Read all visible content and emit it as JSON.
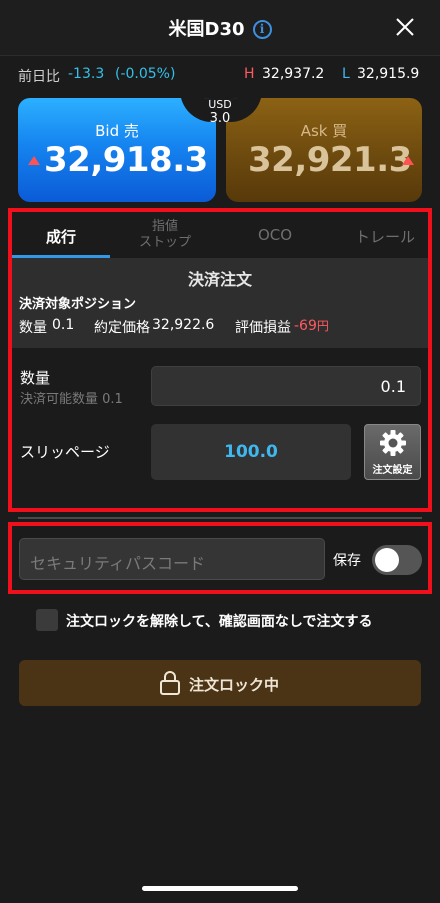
{
  "header": {
    "title": "米国D30",
    "info_icon": "i"
  },
  "stats": {
    "change_label": "前日比",
    "change_value": "-13.3",
    "change_pct": "(-0.05%)",
    "high_label": "H",
    "high_value": "32,937.2",
    "low_label": "L",
    "low_value": "32,915.9"
  },
  "bid": {
    "label": "Bid 売",
    "price": "32,918.3"
  },
  "ask": {
    "label": "Ask 買",
    "price": "32,921.3"
  },
  "spread": {
    "currency": "USD",
    "value": "3.0"
  },
  "tabs": [
    {
      "label": "成行"
    },
    {
      "label_line1": "指値",
      "label_line2": "ストップ"
    },
    {
      "label": "OCO"
    },
    {
      "label": "トレール"
    }
  ],
  "settle": {
    "title": "決済注文",
    "position_title": "決済対象ポジション",
    "qty_label": "数量",
    "qty_value": "0.1",
    "price_label": "約定価格",
    "price_value": "32,922.6",
    "pnl_label": "評価損益",
    "pnl_value": "-69",
    "pnl_unit": "円"
  },
  "quantity": {
    "label": "数量",
    "sub": "決済可能数量 0.1",
    "value": "0.1"
  },
  "slippage": {
    "label": "スリッページ",
    "value": "100.0",
    "settings_label": "注文設定"
  },
  "security": {
    "placeholder": "セキュリティパスコード",
    "save_label": "保存",
    "save_on": false
  },
  "unlock": {
    "label": "注文ロックを解除して、確認画面なしで注文する",
    "checked": false
  },
  "lock_button": {
    "label": "注文ロック中"
  },
  "colors": {
    "accent": "#3399e6",
    "negative": "#ff5a5f",
    "highlight_box": "#f0101c"
  }
}
